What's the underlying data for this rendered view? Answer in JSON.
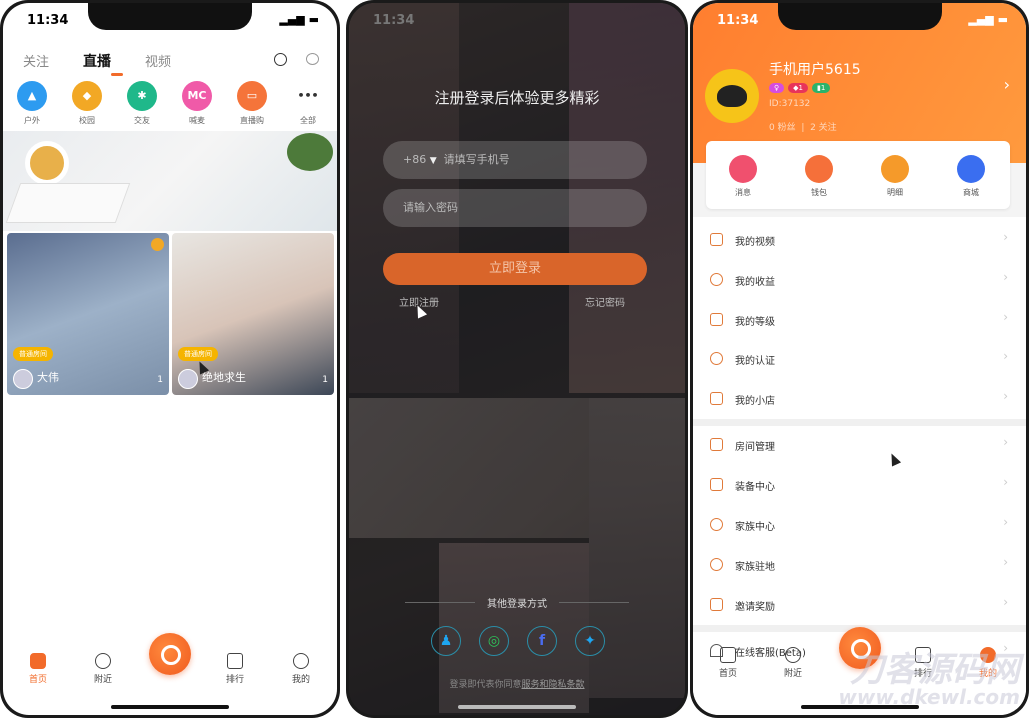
{
  "status": {
    "time": "11:34"
  },
  "home": {
    "tabs": [
      {
        "label": "关注"
      },
      {
        "label": "直播"
      },
      {
        "label": "视频"
      }
    ],
    "categories": [
      {
        "label": "户外",
        "color": "#2d9bf0"
      },
      {
        "label": "校园",
        "color": "#f2a825"
      },
      {
        "label": "交友",
        "color": "#1fb88a"
      },
      {
        "label": "喊麦",
        "color": "#f05aa8",
        "glyph": "MC"
      },
      {
        "label": "直播购",
        "color": "#f5743a"
      },
      {
        "label": "全部",
        "glyph": "•••"
      }
    ],
    "cards": [
      {
        "tag": "普通房间",
        "name": "大伟",
        "count": "1"
      },
      {
        "tag": "普通房间",
        "name": "绝地求生",
        "count": "1"
      }
    ],
    "tabbar": [
      {
        "label": "首页"
      },
      {
        "label": "附近"
      },
      {
        "label": "排行"
      },
      {
        "label": "我的"
      }
    ]
  },
  "login": {
    "title": "注册登录后体验更多精彩",
    "country_code": "+86",
    "phone_placeholder": "请填写手机号",
    "password_placeholder": "请输入密码",
    "login_button": "立即登录",
    "register_link": "立即注册",
    "forgot_link": "忘记密码",
    "other_methods": "其他登录方式",
    "social": [
      {
        "name": "qq",
        "glyph": "♟",
        "color": "#1ea5f0"
      },
      {
        "name": "wechat",
        "glyph": "◎",
        "color": "#2ec55a"
      },
      {
        "name": "facebook",
        "glyph": "f",
        "color": "#4a6cf0"
      },
      {
        "name": "twitter",
        "glyph": "✦",
        "color": "#1ea5f0"
      }
    ],
    "terms_prefix": "登录即代表你同意",
    "terms_link": "服务和隐私条款"
  },
  "profile": {
    "username": "手机用户5615",
    "badges": [
      {
        "text": "♀",
        "color": "#d64de0"
      },
      {
        "text": "◆1",
        "color": "#e8345a"
      },
      {
        "text": "▮1",
        "color": "#2bb36a"
      }
    ],
    "id": "ID:37132",
    "fans": "0 粉丝",
    "following": "2 关注",
    "quick": [
      {
        "label": "消息",
        "color": "#f0506e"
      },
      {
        "label": "钱包",
        "color": "#f5703a"
      },
      {
        "label": "明细",
        "color": "#f59a2a"
      },
      {
        "label": "商城",
        "color": "#3a6ef0"
      }
    ],
    "menu_group1": [
      {
        "label": "我的视频"
      },
      {
        "label": "我的收益"
      },
      {
        "label": "我的等级"
      },
      {
        "label": "我的认证"
      },
      {
        "label": "我的小店"
      }
    ],
    "menu_group2": [
      {
        "label": "房间管理"
      },
      {
        "label": "装备中心"
      },
      {
        "label": "家族中心"
      },
      {
        "label": "家族驻地"
      },
      {
        "label": "邀请奖励"
      }
    ],
    "menu_group3": [
      {
        "label": "在线客服(Beta)"
      }
    ],
    "tabbar": [
      {
        "label": "首页"
      },
      {
        "label": "附近"
      },
      {
        "label": "排行"
      },
      {
        "label": "我的"
      }
    ]
  },
  "watermark": {
    "line1": "刀客源码网",
    "line2": "www.dkewl.com"
  },
  "colors": {
    "accent": "#f26b2a"
  }
}
